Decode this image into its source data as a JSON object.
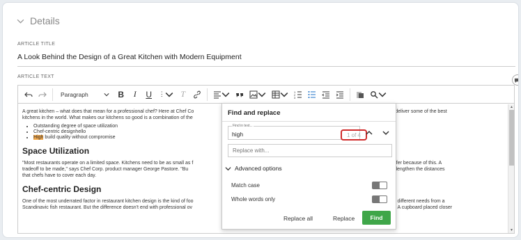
{
  "details": {
    "label": "Details"
  },
  "article_title": {
    "label": "ARTICLE TITLE",
    "value": "A Look Behind the Design of a Great Kitchen with Modern Equipment"
  },
  "article_text": {
    "label": "ARTICLE TEXT"
  },
  "toolbar": {
    "paragraph": "Paragraph",
    "bold": "B",
    "italic": "I",
    "underline": "U",
    "more": "⋮",
    "clear": "T"
  },
  "content": {
    "p1": "A great kitchen – what does that mean for a professional chef? Here at Chef Co",
    "p1b": "sign, build, and deliver some of the best",
    "p1c": "kitchens in the world. What makes our kitchens so good is a combination of the",
    "list": [
      "Outstanding degree of space utilization",
      "Chef-centric designhello"
    ],
    "list3_hl": "High",
    "list3_rest": " build quality without compromise",
    "h1": "Space Utilization",
    "p2a": "\"Most restaurants operate on a limited space. Kitchens need to be as small as f",
    "p2b": "ood quality can't suffer because of this. A",
    "p2c": "tradeoff to be made,\" says Chef Corp. product manager George Pastore. \"Bu",
    "p2d": "ge kitchens also lengthen the distances",
    "p2e": "that chefs have to cover each day.",
    "h2": "Chef-centric Design",
    "p3a": "One of the most underrated factor in restaurant kitchen design is the kind of foo",
    "p3b": "aurant has different needs from a",
    "p3c": "Scandinavic fish restaurant. But the difference doesn't end with professional ov",
    "p3d": "can be achieved. A cupboard placed closer"
  },
  "find_replace": {
    "title": "Find and replace",
    "find_label": "Find in text...",
    "find_value": "high",
    "count": "1 of 4",
    "replace_placeholder": "Replace with...",
    "advanced": "Advanced options",
    "match_case": "Match case",
    "whole_words": "Whole words only",
    "replace_all": "Replace all",
    "replace": "Replace",
    "find": "Find"
  }
}
